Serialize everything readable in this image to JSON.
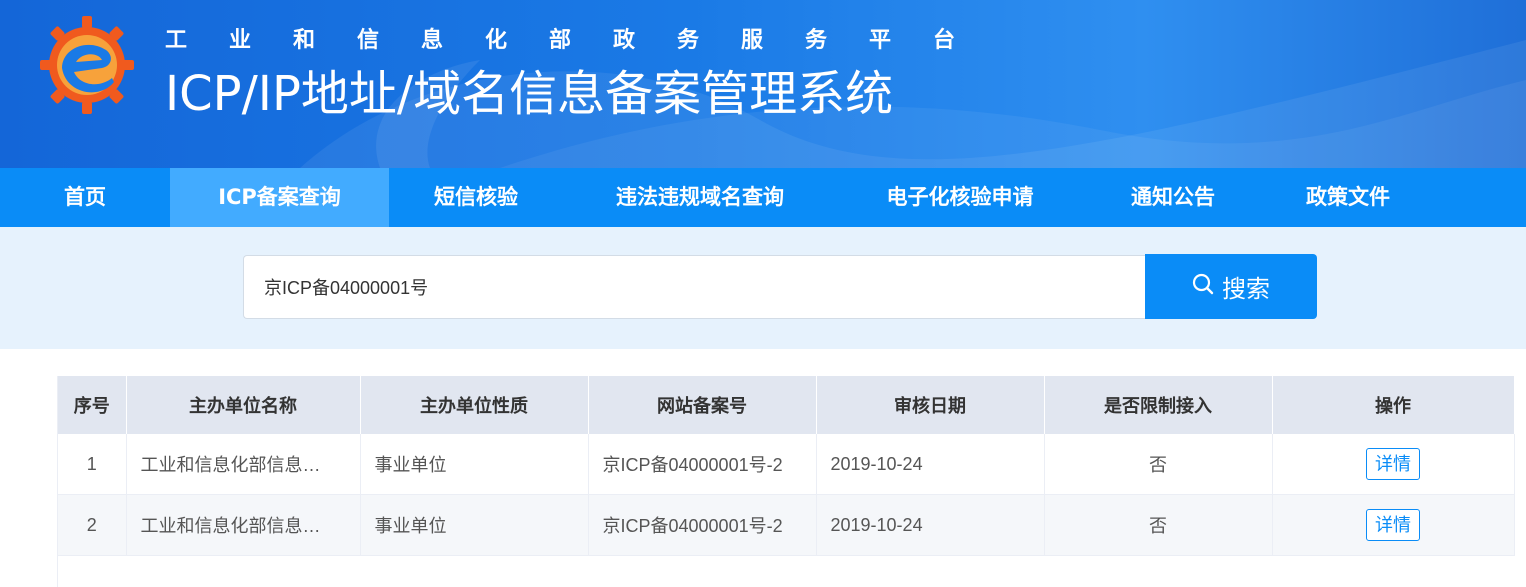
{
  "header": {
    "subtitle": "工业和信息化部政务服务平台",
    "title": "ICP/IP地址/域名信息备案管理系统",
    "logo_icon": "gear-e-logo-icon"
  },
  "nav": {
    "items": [
      {
        "label": "首页",
        "active": false
      },
      {
        "label": "ICP备案查询",
        "active": true
      },
      {
        "label": "短信核验",
        "active": false
      },
      {
        "label": "违法违规域名查询",
        "active": false
      },
      {
        "label": "电子化核验申请",
        "active": false
      },
      {
        "label": "通知公告",
        "active": false
      },
      {
        "label": "政策文件",
        "active": false
      }
    ]
  },
  "search": {
    "value": "京ICP备04000001号",
    "button_label": "搜索",
    "button_icon": "search-icon"
  },
  "table": {
    "columns": [
      "序号",
      "主办单位名称",
      "主办单位性质",
      "网站备案号",
      "审核日期",
      "是否限制接入",
      "操作"
    ],
    "rows": [
      {
        "index": "1",
        "org_name": "工业和信息化部信息…",
        "org_type": "事业单位",
        "record_no": "京ICP备04000001号-2",
        "date": "2019-10-24",
        "restricted": "否",
        "action": "详情"
      },
      {
        "index": "2",
        "org_name": "工业和信息化部信息…",
        "org_type": "事业单位",
        "record_no": "京ICP备04000001号-2",
        "date": "2019-10-24",
        "restricted": "否",
        "action": "详情"
      }
    ]
  },
  "colors": {
    "nav_bg": "#0a8cf7",
    "nav_active": "#42abff",
    "search_band": "#e6f2fd",
    "logo_orange": "#f05a1e"
  }
}
